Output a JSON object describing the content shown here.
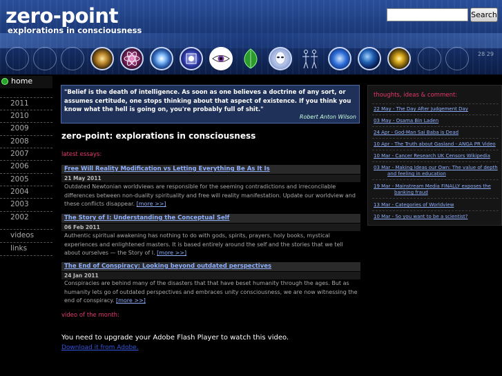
{
  "header": {
    "title": "zero-point",
    "subtitle": "explorations in consciousness",
    "side_text": "28 29"
  },
  "search": {
    "value": "",
    "button_label": "Search"
  },
  "orbs": [
    {
      "name": "galaxy-orb-icon",
      "color": "#b9852a"
    },
    {
      "name": "atom-orb-icon",
      "color": "#8a2a6a"
    },
    {
      "name": "star-burst-orb-icon",
      "color": "#2b5fb0"
    },
    {
      "name": "mandala-orb-icon",
      "color": "#2d3aa8"
    },
    {
      "name": "eye-orb-icon",
      "color": "#ffffff"
    },
    {
      "name": "leaf-orb-icon",
      "color": "#2e9a2e"
    },
    {
      "name": "alien-face-orb-icon",
      "color": "#c7d7f7"
    },
    {
      "name": "human-figures-orb-icon",
      "color": "#c7d7f7"
    },
    {
      "name": "sun-orb-icon",
      "color": "#2b6bd6"
    },
    {
      "name": "earth-orb-icon",
      "color": "#0b2a6a"
    },
    {
      "name": "sun-glow-orb-icon",
      "color": "#e0b020"
    }
  ],
  "nav": {
    "home": "home",
    "years": [
      "2011",
      "2010",
      "2009",
      "2008",
      "2007",
      "2006",
      "2005",
      "2004",
      "2003",
      "2002"
    ],
    "videos": "videos",
    "links": "links"
  },
  "quote": {
    "text": "\"Belief is the death of intelligence. As soon as one believes a doctrine of any sort, or assumes certitude, one stops thinking about that aspect of existence. If you think you know what the hell is going on, you're probably full of shit.\"",
    "author": "Robert Anton Wilson"
  },
  "main": {
    "heading": "zero-point: explorations in consciousness",
    "latest_label": "latest essays:",
    "essays": [
      {
        "title": "Free Will Reality Modification vs Letting Everything Be As It Is",
        "date": "21 May 2011",
        "body": "Outdated Newtonian worldviews are responsible for the seeming contradictions and irreconcilable differences between non-duality spirituality and free will reality manifestation. Update our worldview and these conflicts disappear.",
        "more": "[more >>]"
      },
      {
        "title": "The Story of I: Understanding the Conceptual Self",
        "date": "06 Feb 2011",
        "body": "Authentic spiritual awakening has nothing to do with gods, spirits, prayers, holy books, mystical experiences and enlightened masters. It is based entirely around the self and the stories that we tell about ourselves — the Story of I.",
        "more": "[more >>]"
      },
      {
        "title": "The End of Conspiracy: Looking beyond outdated perspectives",
        "date": "24 Jan 2011",
        "body": "Conspiracies are behind many of the disasters that that have beset humanity through the ages. But as humanity lets go of outdated perspectives and embraces unity consciousness, we are now witnessing the end of conspiracy.",
        "more": "[more >>]"
      }
    ],
    "video_label": "video of the month:",
    "flash_message": "You need to upgrade your Adobe Flash Player to watch this video.",
    "flash_link": "Download it from Adobe."
  },
  "sidebar": {
    "heading": "thoughts, ideas & comment:",
    "links": [
      {
        "line1": "22 May - The Day After Judgement Day",
        "line2": ""
      },
      {
        "line1": "03 May - Osama Bin Laden",
        "line2": ""
      },
      {
        "line1": "24 Apr - God-Man Sai Baba is Dead",
        "line2": ""
      },
      {
        "line1": "10 Apr - The Truth about Gasland - ANGA PR Video",
        "line2": ""
      },
      {
        "line1": "10 Mar - Cancer Research UK Censors Wikipedia",
        "line2": ""
      },
      {
        "line1": "03 Mar - Making Ideas our Own: The value of depth",
        "line2": "and feeling in education"
      },
      {
        "line1": "19 Mar - Mainstream Media FINALLY exposes the",
        "line2": "banking fraud"
      },
      {
        "line1": "13 Mar - Categories of Worldview",
        "line2": ""
      },
      {
        "line1": "10 Mar - So you want to be a scientist?",
        "line2": ""
      }
    ]
  }
}
